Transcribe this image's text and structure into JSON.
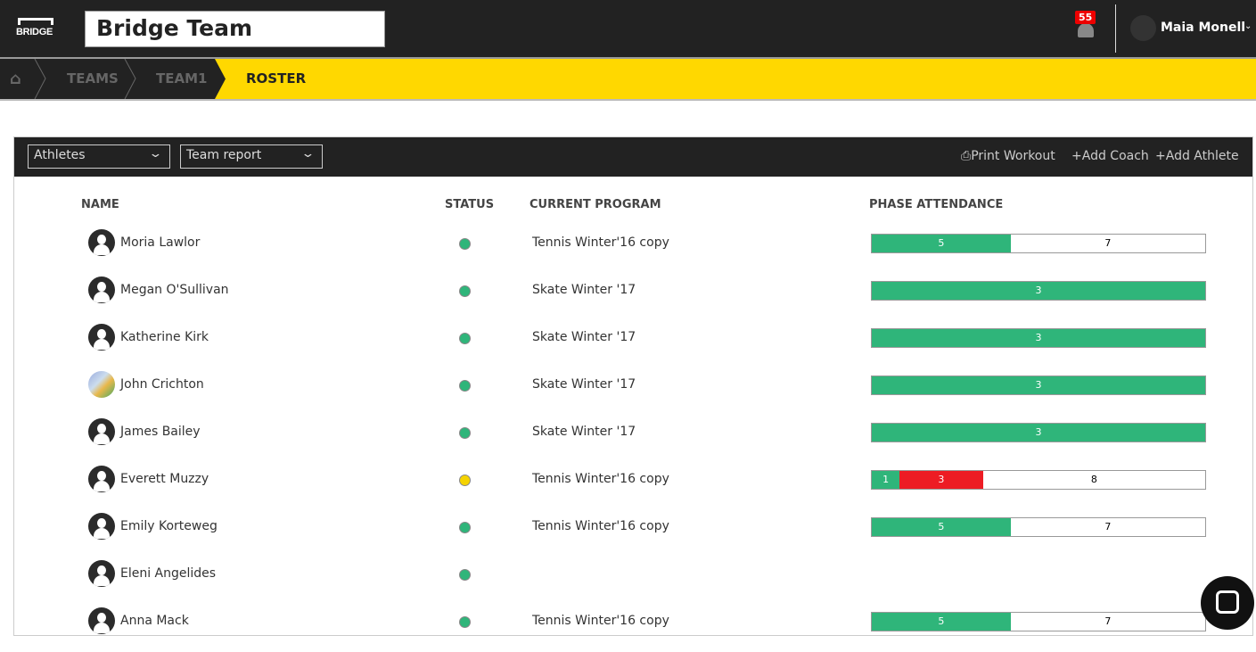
{
  "header": {
    "logo": "BRIDGE",
    "team_name": "Bridge Team",
    "notifications": "55",
    "user_name": "Maia Monell"
  },
  "breadcrumb": [
    {
      "label": "TEAMS"
    },
    {
      "label": "TEAM1"
    },
    {
      "label": "ROSTER"
    }
  ],
  "toolbar": {
    "filter": "Athletes",
    "report": "Team report",
    "print": "Print Workout",
    "add_coach": "Add Coach",
    "add_athlete": "Add Athlete"
  },
  "columns": {
    "name": "NAME",
    "status": "STATUS",
    "program": "CURRENT PROGRAM",
    "attendance": "PHASE ATTENDANCE"
  },
  "colors": {
    "green": "#2fb57a",
    "yellow": "#f5d300",
    "red": "#ed1c24"
  },
  "rows": [
    {
      "name": "Moria Lawlor",
      "status": "green",
      "program": "Tennis Winter'16 copy",
      "attendance": [
        {
          "v": 5,
          "c": "green"
        },
        {
          "v": 7,
          "c": "white"
        }
      ]
    },
    {
      "name": "Megan O'Sullivan",
      "status": "green",
      "program": "Skate Winter '17",
      "attendance": [
        {
          "v": 3,
          "c": "green"
        }
      ]
    },
    {
      "name": "Katherine Kirk",
      "status": "green",
      "program": "Skate Winter '17",
      "attendance": [
        {
          "v": 3,
          "c": "green"
        }
      ]
    },
    {
      "name": "John Crichton",
      "status": "green",
      "program": "Skate Winter '17",
      "photo": true,
      "attendance": [
        {
          "v": 3,
          "c": "green"
        }
      ]
    },
    {
      "name": "James Bailey",
      "status": "green",
      "program": "Skate Winter '17",
      "attendance": [
        {
          "v": 3,
          "c": "green"
        }
      ]
    },
    {
      "name": "Everett Muzzy",
      "status": "yellow",
      "program": "Tennis Winter'16 copy",
      "attendance": [
        {
          "v": 1,
          "c": "green"
        },
        {
          "v": 3,
          "c": "red"
        },
        {
          "v": 8,
          "c": "white"
        }
      ]
    },
    {
      "name": "Emily Korteweg",
      "status": "green",
      "program": "Tennis Winter'16 copy",
      "attendance": [
        {
          "v": 5,
          "c": "green"
        },
        {
          "v": 7,
          "c": "white"
        }
      ]
    },
    {
      "name": "Eleni Angelides",
      "status": "green",
      "program": "",
      "attendance": []
    },
    {
      "name": "Anna Mack",
      "status": "green",
      "program": "Tennis Winter'16 copy",
      "attendance": [
        {
          "v": 5,
          "c": "green"
        },
        {
          "v": 7,
          "c": "white"
        }
      ]
    }
  ]
}
